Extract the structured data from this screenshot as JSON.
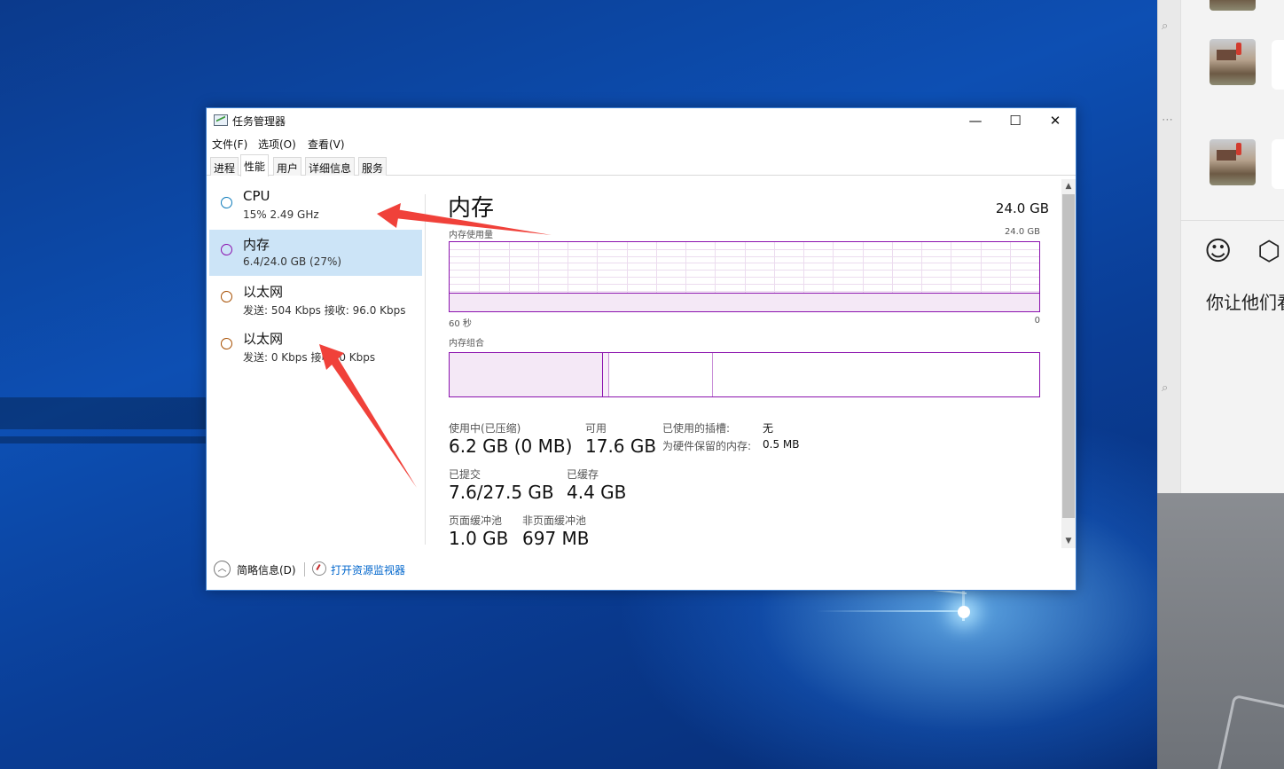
{
  "window": {
    "title": "任务管理器",
    "controls": {
      "minimize": "—",
      "maximize": "☐",
      "close": "✕"
    }
  },
  "menu": [
    "文件(F)",
    "选项(O)",
    "查看(V)"
  ],
  "tabs": [
    {
      "label": "进程",
      "active": false
    },
    {
      "label": "性能",
      "active": true
    },
    {
      "label": "用户",
      "active": false
    },
    {
      "label": "详细信息",
      "active": false
    },
    {
      "label": "服务",
      "active": false
    }
  ],
  "sidebar": [
    {
      "name": "CPU",
      "sub": "15% 2.49 GHz",
      "selected": false,
      "color": "#117dbb"
    },
    {
      "name": "内存",
      "sub": "6.4/24.0 GB (27%)",
      "selected": true,
      "color": "#8b12ae"
    },
    {
      "name": "以太网",
      "sub": "发送: 504 Kbps 接收: 96.0 Kbps",
      "selected": false,
      "color": "#a74f01"
    },
    {
      "name": "以太网",
      "sub": "发送: 0 Kbps 接收: 0 Kbps",
      "selected": false,
      "color": "#a74f01"
    }
  ],
  "detail": {
    "title": "内存",
    "total": "24.0 GB",
    "usage_label": "内存使用量",
    "usage_max": "24.0 GB",
    "usage_fraction": 0.27,
    "time_left": "60 秒",
    "time_right": "0",
    "composition_label": "内存组合",
    "stats": {
      "in_use_label": "使用中(已压缩)",
      "in_use_value": "6.2 GB (0 MB)",
      "available_label": "可用",
      "available_value": "17.6 GB",
      "committed_label": "已提交",
      "committed_value": "7.6/27.5 GB",
      "cached_label": "已缓存",
      "cached_value": "4.4 GB",
      "paged_label": "页面缓冲池",
      "paged_value": "1.0 GB",
      "nonpaged_label": "非页面缓冲池",
      "nonpaged_value": "697 MB"
    },
    "kv": {
      "slots_label": "已使用的插槽:",
      "slots_value": "无",
      "reserved_label": "为硬件保留的内存:",
      "reserved_value": "0.5 MB"
    }
  },
  "footer": {
    "summary_label": "简略信息(D)",
    "monitor_link": "打开资源监视器"
  },
  "chat": {
    "input_text": "你让他们看",
    "emoji_icon": "☺",
    "box_icon": "⬡"
  },
  "colors": {
    "memory": "#8b12ae",
    "selected_bg": "#cce4f7",
    "link": "#0066cc",
    "arrow": "#f0413a"
  }
}
